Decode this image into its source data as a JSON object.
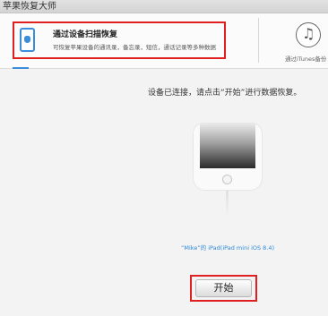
{
  "window": {
    "title": "苹果恢复大师"
  },
  "modes": {
    "device_scan": {
      "title": "通过设备扫描恢复",
      "desc": "可恢复苹果设备的通讯录，备忘录，短信，通话记录等多种数据"
    },
    "itunes_backup": {
      "label": "通过iTunes备份"
    }
  },
  "main": {
    "status_message": "设备已连接，请点击“开始”进行数据恢复。",
    "device_label": "“Mike”的 iPad(iPad mini iOS 8.4)",
    "start_button": "开始"
  },
  "colors": {
    "accent": "#3b8ddb",
    "highlight": "#e02020",
    "device_label": "#2f8ad8"
  },
  "icons": {
    "device_mode": "ipad-apple-icon",
    "itunes_mode": "music-note-icon"
  }
}
